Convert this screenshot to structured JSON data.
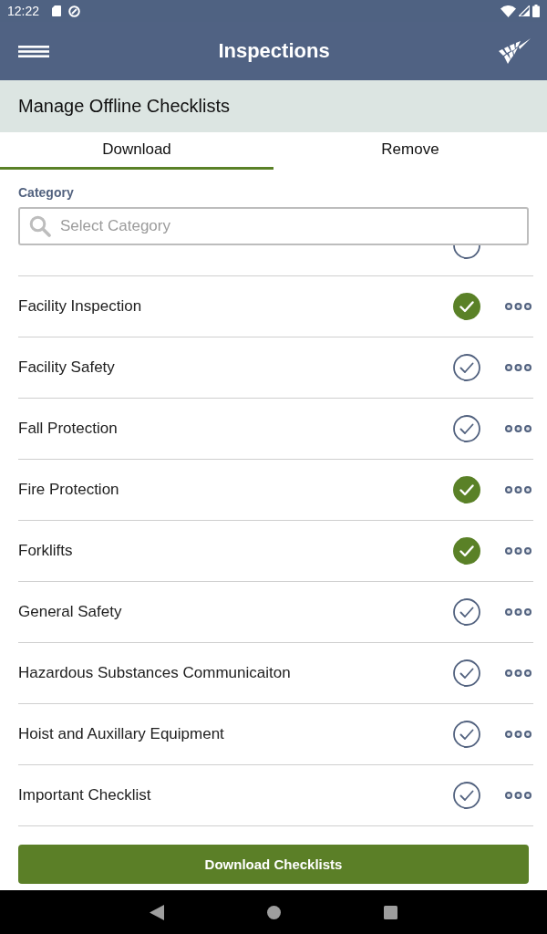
{
  "status_bar": {
    "time": "12:22"
  },
  "app_bar": {
    "title": "Inspections"
  },
  "subheader": {
    "title": "Manage Offline Checklists"
  },
  "tabs": [
    {
      "label": "Download",
      "selected": true
    },
    {
      "label": "Remove",
      "selected": false
    }
  ],
  "category": {
    "label": "Category",
    "placeholder": "Select Category"
  },
  "partial_row": {
    "checked": false
  },
  "checklists": [
    {
      "name": "Facility Inspection",
      "checked": true
    },
    {
      "name": "Facility Safety",
      "checked": false
    },
    {
      "name": "Fall Protection",
      "checked": false
    },
    {
      "name": "Fire Protection",
      "checked": true
    },
    {
      "name": "Forklifts",
      "checked": true
    },
    {
      "name": "General Safety",
      "checked": false
    },
    {
      "name": "Hazardous Substances Communicaiton",
      "checked": false
    },
    {
      "name": "Hoist and Auxillary Equipment",
      "checked": false
    },
    {
      "name": "Important Checklist",
      "checked": false
    }
  ],
  "download_button": {
    "label": "Download Checklists"
  }
}
